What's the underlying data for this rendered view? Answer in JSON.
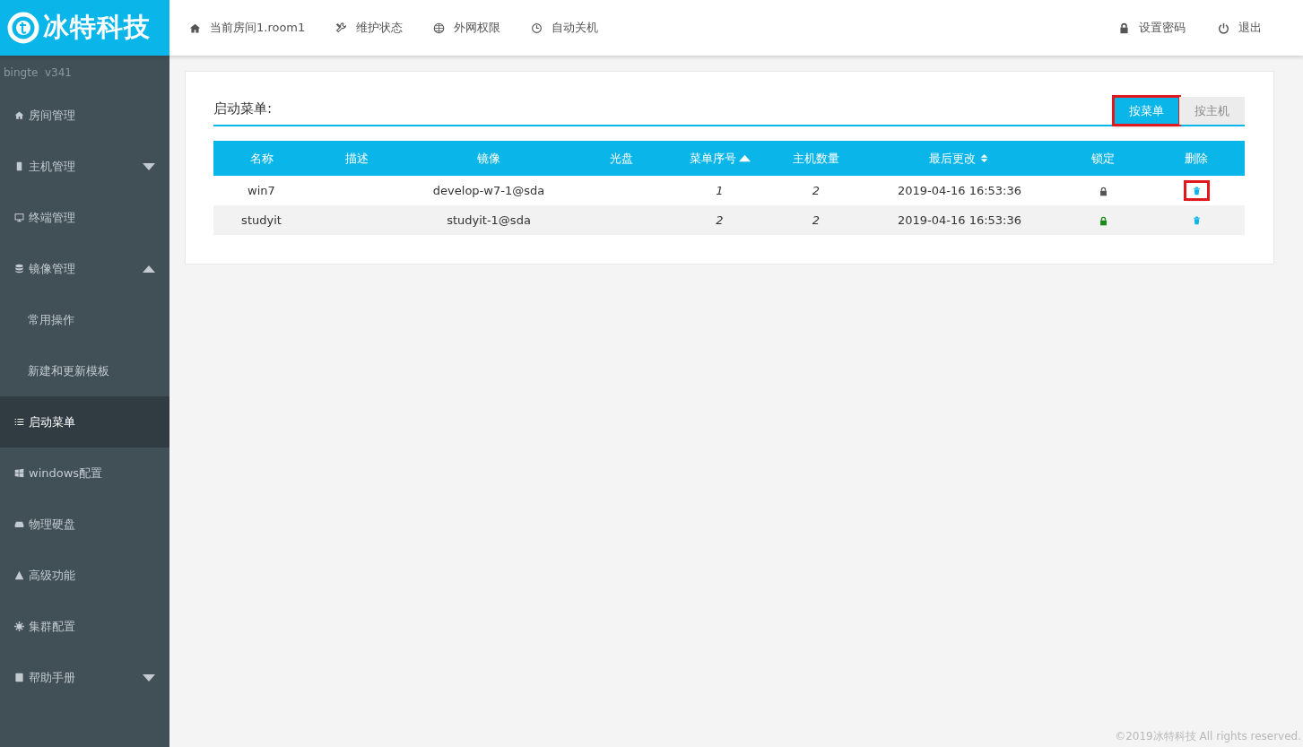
{
  "logo": {
    "text": "冰特科技"
  },
  "topnav": [
    {
      "label": "当前房间1.room1"
    },
    {
      "label": "维护状态"
    },
    {
      "label": "外网权限"
    },
    {
      "label": "自动关机"
    }
  ],
  "topnav_right": [
    {
      "label": "设置密码"
    },
    {
      "label": "退出"
    }
  ],
  "version": "bingte  v341",
  "sidebar": {
    "items": [
      {
        "label": "房间管理",
        "selected": false
      },
      {
        "label": "主机管理",
        "selected": false,
        "expanded": false
      },
      {
        "label": "终端管理",
        "selected": false
      },
      {
        "label": "镜像管理",
        "selected": false,
        "expanded": true,
        "children": [
          {
            "label": "常用操作",
            "selected": false
          },
          {
            "label": "新建和更新模板",
            "selected": false
          }
        ]
      },
      {
        "label": "启动菜单",
        "selected": true
      },
      {
        "label": "windows配置",
        "selected": false
      },
      {
        "label": "物理硬盘",
        "selected": false
      },
      {
        "label": "高级功能",
        "selected": false
      },
      {
        "label": "集群配置",
        "selected": false
      },
      {
        "label": "帮助手册",
        "selected": false,
        "expanded": false
      }
    ]
  },
  "panel": {
    "title": "启动菜单:",
    "tabs": [
      {
        "label": "按菜单",
        "selected": true,
        "highlighted": true
      },
      {
        "label": "按主机",
        "selected": false,
        "highlighted": false
      }
    ],
    "table": {
      "columns": [
        {
          "label": "名称",
          "kind": "plain"
        },
        {
          "label": "描述",
          "kind": "plain"
        },
        {
          "label": "镜像",
          "kind": "plain"
        },
        {
          "label": "光盘",
          "kind": "plain"
        },
        {
          "label": "菜单序号",
          "kind": "sorted"
        },
        {
          "label": "主机数量",
          "kind": "plain"
        },
        {
          "label": "最后更改",
          "kind": "sortable"
        },
        {
          "label": "锁定",
          "kind": "plain"
        },
        {
          "label": "删除",
          "kind": "plain"
        }
      ],
      "rows": [
        {
          "cells": [
            "win7",
            "",
            "develop-w7-1@sda",
            "",
            "1",
            "2",
            "2019-04-16 16:53:36"
          ],
          "color": "#555555",
          "delete_highlighted": true
        },
        {
          "cells": [
            "studyit",
            "",
            "studyit-1@sda",
            "",
            "2",
            "2",
            "2019-04-16 16:53:36"
          ],
          "color": "#1a8a1a",
          "delete_highlighted": false
        }
      ]
    }
  },
  "footer": "©2019冰特科技 All rights reserved."
}
